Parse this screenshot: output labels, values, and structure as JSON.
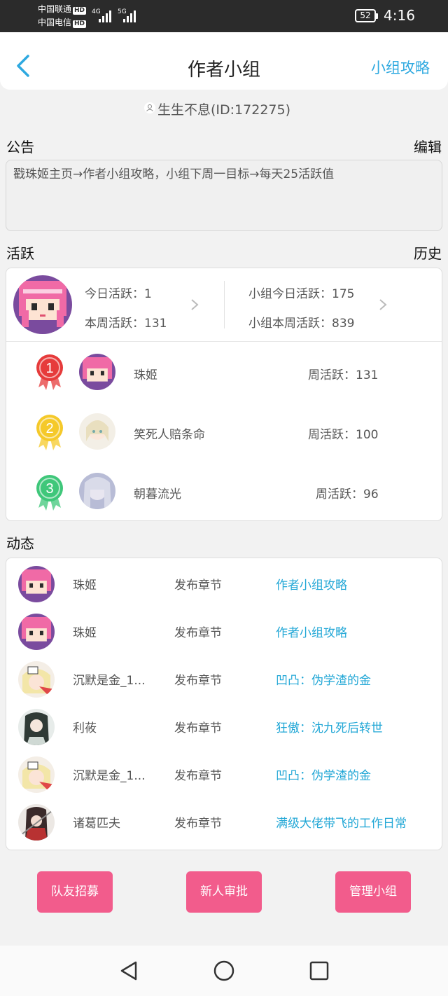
{
  "status": {
    "carrier1": "中国联通",
    "carrier2": "中国电信",
    "hd": "HD",
    "net1": "4G",
    "net2": "5G",
    "battery": "52",
    "time": "4:16"
  },
  "nav": {
    "title": "作者小组",
    "guide": "小组攻略"
  },
  "leader": {
    "text": "生生不息(ID:172275)"
  },
  "notice": {
    "title": "公告",
    "edit": "编辑",
    "content": "戳珠姬主页→作者小组攻略，小组下周一目标→每天25活跃值"
  },
  "activity": {
    "title": "活跃",
    "history": "历史",
    "today": "今日活跃：1",
    "week": "本周活跃：131",
    "group_today": "小组今日活跃：175",
    "group_week": "小组本周活跃：839",
    "ranking": [
      {
        "rank": "1",
        "name": "珠姬",
        "weekly": "周活跃：131",
        "medal_color": "#e63b3b"
      },
      {
        "rank": "2",
        "name": "笑死人赔条命",
        "weekly": "周活跃：100",
        "medal_color": "#f5c92a"
      },
      {
        "rank": "3",
        "name": "朝暮流光",
        "weekly": "周活跃：96",
        "medal_color": "#3fc77a"
      }
    ]
  },
  "feed": {
    "title": "动态",
    "rows": [
      {
        "user": "珠姬",
        "action": "发布章节",
        "target": "作者小组攻略"
      },
      {
        "user": "珠姬",
        "action": "发布章节",
        "target": "作者小组攻略"
      },
      {
        "user": "沉默是金_1...",
        "action": "发布章节",
        "target": "凹凸：伪学渣的金"
      },
      {
        "user": "利莜",
        "action": "发布章节",
        "target": "狂傲：沈九死后转世"
      },
      {
        "user": "沉默是金_1...",
        "action": "发布章节",
        "target": "凹凸：伪学渣的金"
      },
      {
        "user": "诸葛匹夫",
        "action": "发布章节",
        "target": "满级大佬带飞的工作日常"
      }
    ]
  },
  "buttons": {
    "recruit": "队友招募",
    "approve": "新人审批",
    "manage": "管理小组"
  },
  "colors": {
    "accent": "#2ea9e0",
    "link": "#22a7d6",
    "button": "#f25c8c"
  }
}
